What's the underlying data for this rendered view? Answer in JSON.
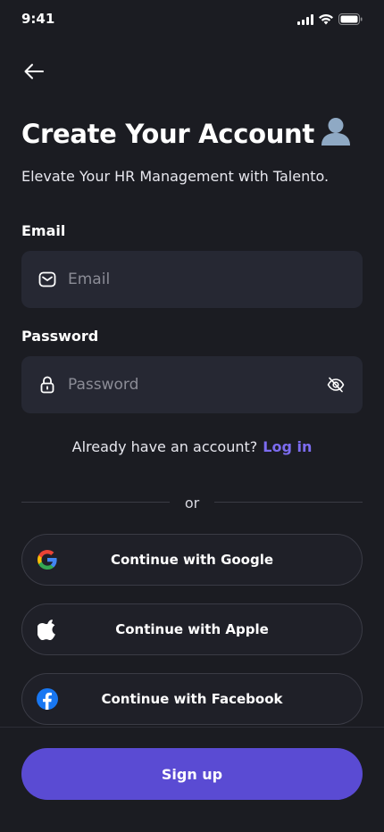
{
  "status_bar": {
    "time": "9:41"
  },
  "header": {
    "title": "Create Your Account",
    "subtitle": "Elevate Your HR Management with Talento."
  },
  "form": {
    "email": {
      "label": "Email",
      "placeholder": "Email",
      "value": ""
    },
    "password": {
      "label": "Password",
      "placeholder": "Password",
      "value": ""
    }
  },
  "login_prompt": {
    "text": "Already have an account?",
    "link": "Log in"
  },
  "divider_text": "or",
  "social": [
    {
      "label": "Continue with Google",
      "icon": "google-icon"
    },
    {
      "label": "Continue with Apple",
      "icon": "apple-icon"
    },
    {
      "label": "Continue with Facebook",
      "icon": "facebook-icon"
    }
  ],
  "signup_label": "Sign up",
  "colors": {
    "background": "#1b1c22",
    "field": "#262833",
    "accent": "#5a4bd3",
    "link": "#7c6cf0"
  }
}
